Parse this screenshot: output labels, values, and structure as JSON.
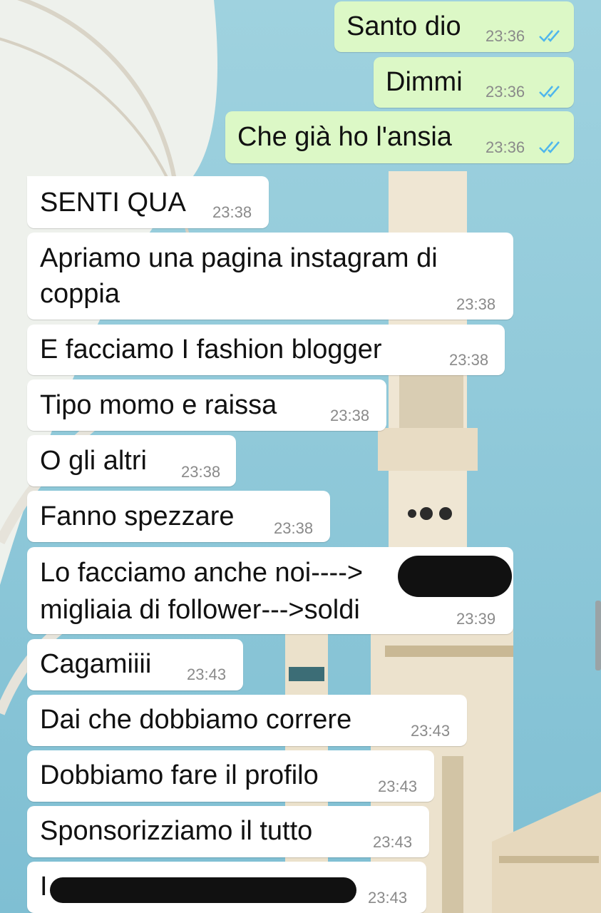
{
  "messages": [
    {
      "dir": "out",
      "text": "Santo dio",
      "time": "23:36",
      "status": "read-double-check"
    },
    {
      "dir": "out",
      "text": "Dimmi",
      "time": "23:36",
      "status": "read-double-check"
    },
    {
      "dir": "out",
      "text": "Che già ho l'ansia",
      "time": "23:36",
      "status": "read-double-check"
    },
    {
      "dir": "in",
      "text": "SENTI QUA",
      "time": "23:38"
    },
    {
      "dir": "in",
      "text": "Apriamo una pagina instagram di",
      "text2": "coppia",
      "time": "23:38"
    },
    {
      "dir": "in",
      "text": "E facciamo I fashion blogger",
      "time": "23:38"
    },
    {
      "dir": "in",
      "text": "Tipo momo e raissa",
      "time": "23:38"
    },
    {
      "dir": "in",
      "text": "O gli altri",
      "time": "23:38"
    },
    {
      "dir": "in",
      "text": "Fanno spezzare",
      "time": "23:38"
    },
    {
      "dir": "in",
      "text": "Lo facciamo anche noi---->",
      "text2": "migliaia di follower--->soldi",
      "time": "23:39",
      "redacted": true
    },
    {
      "dir": "in",
      "text": "Cagamiiii",
      "time": "23:43"
    },
    {
      "dir": "in",
      "text": "Dai che dobbiamo correre",
      "time": "23:43"
    },
    {
      "dir": "in",
      "text": "Dobbiamo fare il profilo",
      "time": "23:43"
    },
    {
      "dir": "in",
      "text": "Sponsorizziamo il tutto",
      "time": "23:43"
    },
    {
      "dir": "in",
      "text": "I",
      "time": "23:43",
      "redacted": true
    }
  ],
  "colors": {
    "incoming_bubble": "#ffffff",
    "outgoing_bubble": "#dcf8c6",
    "read_ticks": "#4fb6ec",
    "wallpaper_sky": "#8ec8d8"
  },
  "icons": {
    "read_status": "double-check-icon",
    "wallpaper": "mosque-minaret-wallpaper"
  }
}
